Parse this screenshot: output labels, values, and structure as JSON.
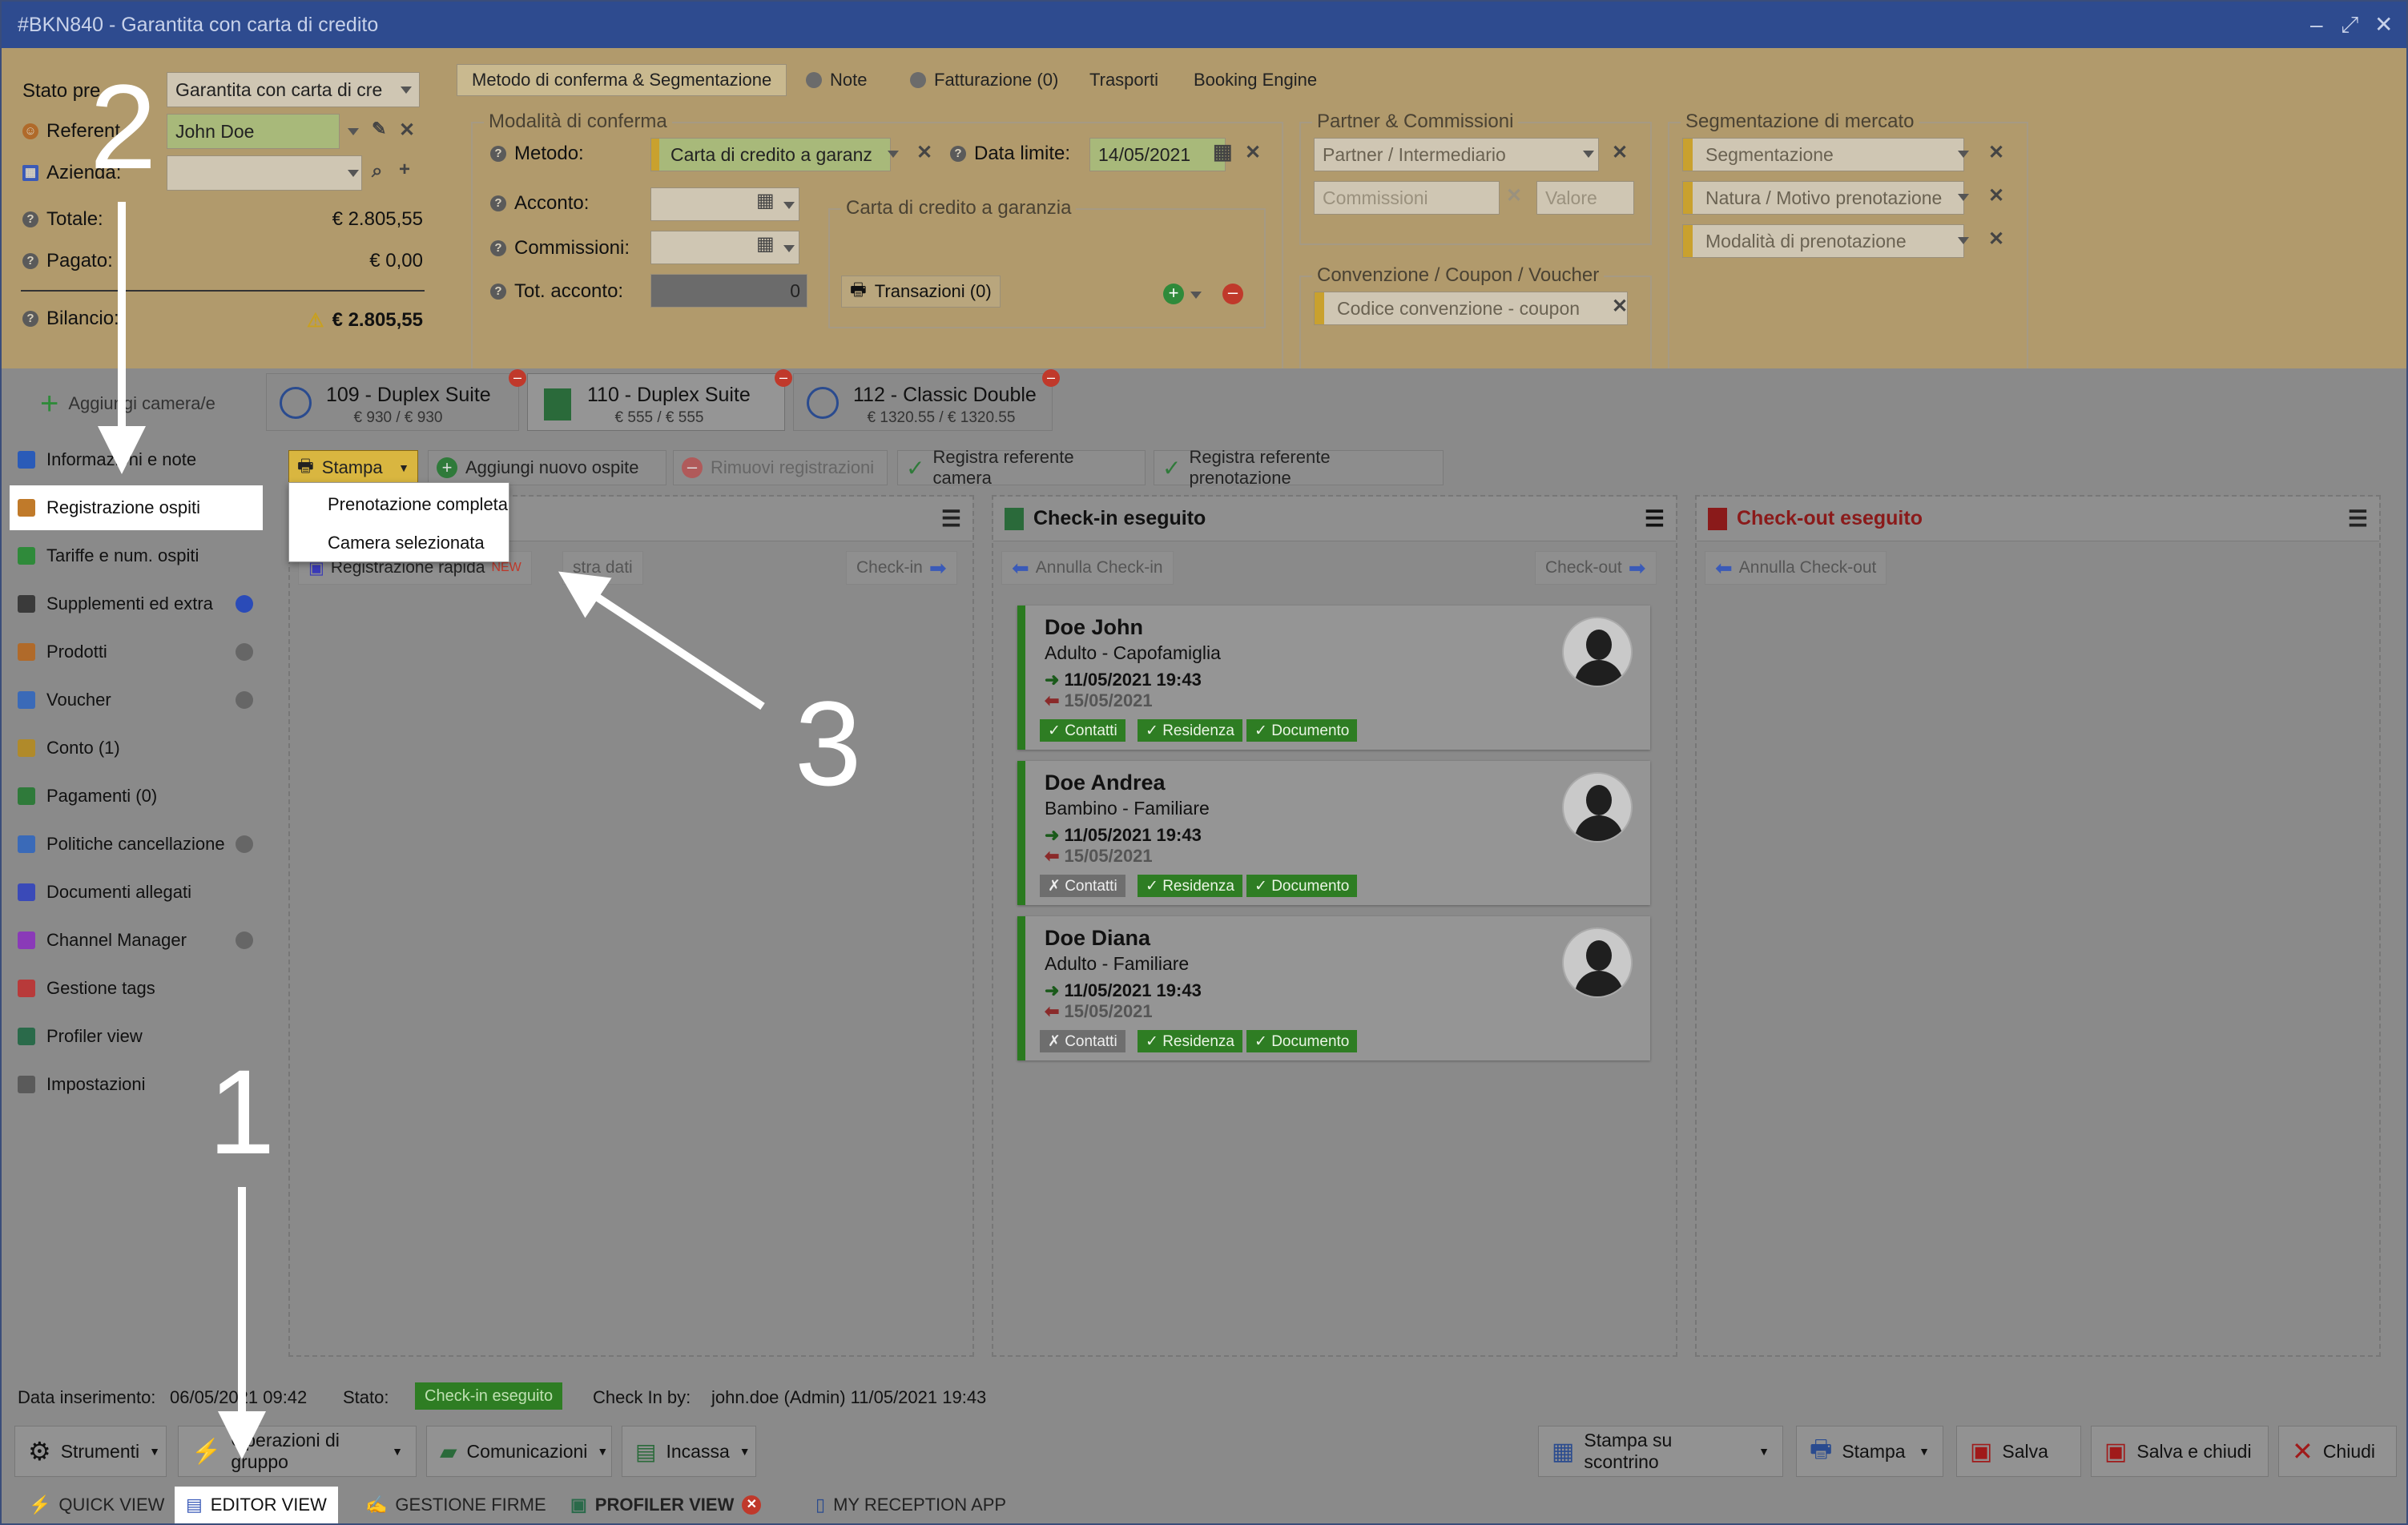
{
  "window": {
    "title": "#BKN840 - Garantita con carta di credito"
  },
  "header": {
    "stato_label": "Stato pre",
    "stato_value": "Garantita con carta di cre",
    "referente_label": "Referent",
    "referente_value": "John Doe",
    "azienda_label": "Azienda:",
    "totale_label": "Totale:",
    "totale_value": "€ 2.805,55",
    "pagato_label": "Pagato:",
    "pagato_value": "€ 0,00",
    "bilancio_label": "Bilancio:",
    "bilancio_value": "€ 2.805,55"
  },
  "header_tabs": [
    {
      "label": "Metodo di conferma & Segmentazione"
    },
    {
      "label": "Note"
    },
    {
      "label": "Fatturazione (0)"
    },
    {
      "label": "Trasporti"
    },
    {
      "label": "Booking Engine"
    }
  ],
  "conferma": {
    "group_title": "Modalità di conferma",
    "metodo_label": "Metodo:",
    "metodo_value": "Carta di credito a garanz",
    "data_limite_label": "Data limite:",
    "data_limite_value": "14/05/2021",
    "acconto_label": "Acconto:",
    "commissioni_label": "Commissioni:",
    "tot_acconto_label": "Tot. acconto:",
    "tot_acconto_value": "0",
    "cc_group_title": "Carta di credito a garanzia",
    "transazioni_label": "Transazioni (0)"
  },
  "partner": {
    "group_title": "Partner & Commissioni",
    "partner_placeholder": "Partner / Intermediario",
    "commissioni_placeholder": "Commissioni",
    "valore_placeholder": "Valore"
  },
  "convenzione": {
    "group_title": "Convenzione / Coupon / Voucher",
    "placeholder": "Codice convenzione - coupon"
  },
  "segmentazione": {
    "group_title": "Segmentazione di mercato",
    "fields": [
      "Segmentazione",
      "Natura / Motivo prenotazione",
      "Modalità di prenotazione"
    ]
  },
  "add_room_label": "Aggiungi camera/e",
  "room_tabs": [
    {
      "title": "109 - Duplex Suite",
      "price": "€ 930 / € 930"
    },
    {
      "title": "110 - Duplex Suite",
      "price": "€ 555 / € 555"
    },
    {
      "title": "112 - Classic Double",
      "price": "€ 1320.55 / € 1320.55"
    }
  ],
  "sidebar": {
    "items": [
      {
        "label": "Informazioni e note",
        "color": "#2a5bb8"
      },
      {
        "label": "Registrazione ospiti",
        "color": "#c07a2a"
      },
      {
        "label": "Tariffe e num. ospiti",
        "color": "#2f8a3a"
      },
      {
        "label": "Supplementi ed extra",
        "color": "#3a3a3a"
      },
      {
        "label": "Prodotti",
        "color": "#b06a2a"
      },
      {
        "label": "Voucher",
        "color": "#3a6ab8"
      },
      {
        "label": "Conto (1)",
        "color": "#b08a2a"
      },
      {
        "label": "Pagamenti (0)",
        "color": "#2f7a3a"
      },
      {
        "label": "Politiche cancellazione",
        "color": "#3a6ab8"
      },
      {
        "label": "Documenti allegati",
        "color": "#3a4ab8"
      },
      {
        "label": "Channel Manager",
        "color": "#8a3ab8"
      },
      {
        "label": "Gestione tags",
        "color": "#b83a3a"
      },
      {
        "label": "Profiler view",
        "color": "#2a6a4a"
      },
      {
        "label": "Impostazioni",
        "color": "#5a5a5a"
      }
    ]
  },
  "toolbar": {
    "stampa": "Stampa",
    "aggiungi_ospite": "Aggiungi nuovo ospite",
    "rimuovi": "Rimuovi registrazioni",
    "registra_camera": "Registra referente camera",
    "registra_prenotazione": "Registra referente prenotazione"
  },
  "dropdown": {
    "options": [
      "Prenotazione completa",
      "Camera selezionata"
    ]
  },
  "panel_left": {
    "registrazione_rapida": "Registrazione rapida",
    "new_badge": "NEW",
    "stra_dati": "stra dati",
    "checkin_btn": "Check-in"
  },
  "panel_checkin": {
    "title": "Check-in eseguito",
    "annulla": "Annulla Check-in",
    "checkout_btn": "Check-out"
  },
  "panel_checkout": {
    "title": "Check-out eseguito",
    "annulla": "Annulla Check-out"
  },
  "guests": [
    {
      "name": "Doe John",
      "role": "Adulto - Capofamiglia",
      "checkin": "11/05/2021 19:43",
      "checkout": "15/05/2021",
      "contatti": "✓ Contatti",
      "residenza": "✓ Residenza",
      "documento": "✓ Documento",
      "contatti_ok": true
    },
    {
      "name": "Doe Andrea",
      "role": "Bambino - Familiare",
      "checkin": "11/05/2021 19:43",
      "checkout": "15/05/2021",
      "contatti": "✗ Contatti",
      "residenza": "✓ Residenza",
      "documento": "✓ Documento",
      "contatti_ok": false
    },
    {
      "name": "Doe Diana",
      "role": "Adulto - Familiare",
      "checkin": "11/05/2021 19:43",
      "checkout": "15/05/2021",
      "contatti": "✗ Contatti",
      "residenza": "✓ Residenza",
      "documento": "✓ Documento",
      "contatti_ok": false
    }
  ],
  "status": {
    "data_label": "Data inserimento:",
    "data_value": "06/05/2021 09:42",
    "stato_label": "Stato:",
    "stato_value": "Check-in eseguito",
    "checkin_by_label": "Check In by:",
    "checkin_by_value": "john.doe (Admin) 11/05/2021 19:43"
  },
  "bottom": {
    "strumenti": "Strumenti",
    "operazioni": "Operazioni di gruppo",
    "comunicazioni": "Comunicazioni",
    "incassa": "Incassa",
    "stampa_scontrino": "Stampa su scontrino",
    "stampa": "Stampa",
    "salva": "Salva",
    "salva_chiudi": "Salva e chiudi",
    "chiudi": "Chiudi"
  },
  "views": [
    "QUICK VIEW",
    "EDITOR VIEW",
    "GESTIONE FIRME",
    "PROFILER VIEW",
    "MY RECEPTION APP"
  ],
  "annotations": {
    "one": "1",
    "two": "2",
    "three": "3"
  }
}
